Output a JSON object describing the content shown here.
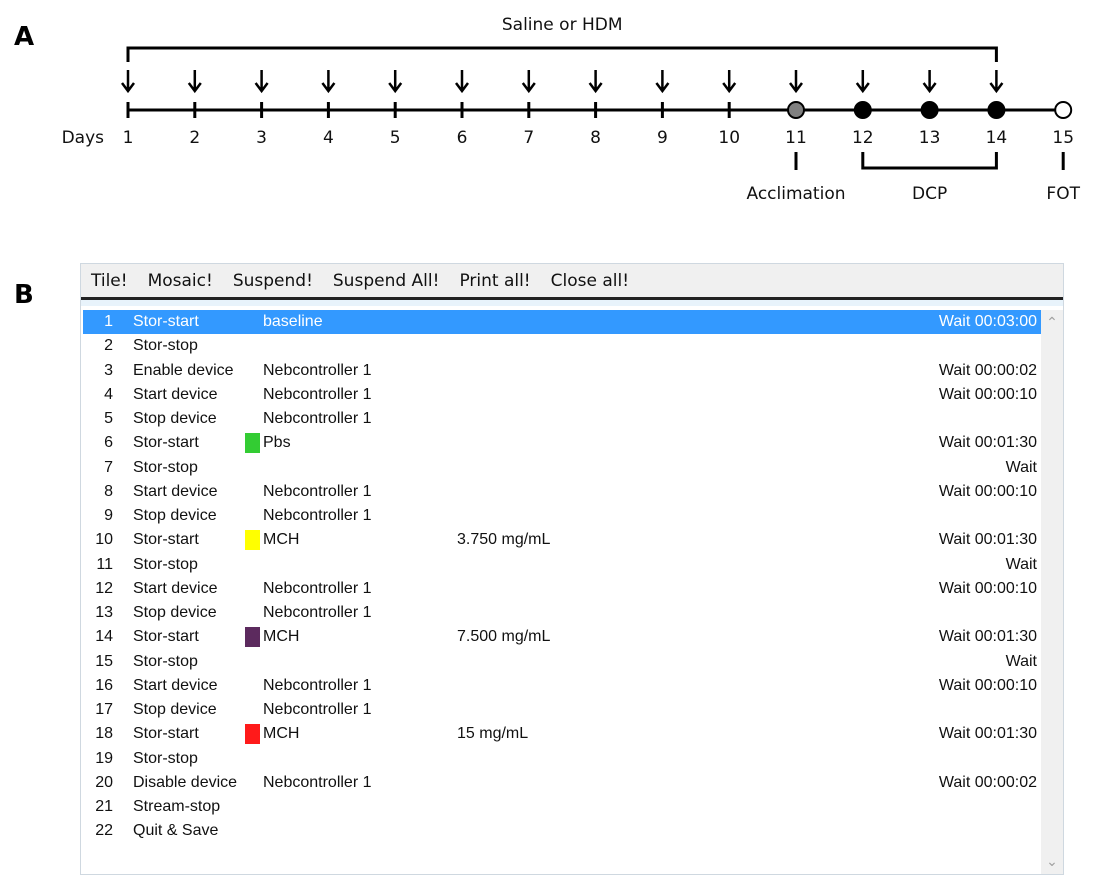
{
  "panel_a": {
    "label": "A",
    "bracket_label": "Saline or HDM",
    "axis_label": "Days",
    "days": [
      {
        "day": "1",
        "arrow": true,
        "marker": "none"
      },
      {
        "day": "2",
        "arrow": true,
        "marker": "none"
      },
      {
        "day": "3",
        "arrow": true,
        "marker": "none"
      },
      {
        "day": "4",
        "arrow": true,
        "marker": "none"
      },
      {
        "day": "5",
        "arrow": true,
        "marker": "none"
      },
      {
        "day": "6",
        "arrow": true,
        "marker": "none"
      },
      {
        "day": "7",
        "arrow": true,
        "marker": "none"
      },
      {
        "day": "8",
        "arrow": true,
        "marker": "none"
      },
      {
        "day": "9",
        "arrow": true,
        "marker": "none"
      },
      {
        "day": "10",
        "arrow": true,
        "marker": "none"
      },
      {
        "day": "11",
        "arrow": true,
        "marker": "gray"
      },
      {
        "day": "12",
        "arrow": true,
        "marker": "black"
      },
      {
        "day": "13",
        "arrow": true,
        "marker": "black"
      },
      {
        "day": "14",
        "arrow": true,
        "marker": "black"
      },
      {
        "day": "15",
        "arrow": false,
        "marker": "white"
      }
    ],
    "annotations": {
      "acclimation": "Acclimation",
      "dcp": "DCP",
      "fot": "FOT"
    },
    "colors": {
      "gray_marker": "#808080",
      "black_marker": "#000000"
    }
  },
  "panel_b": {
    "label": "B",
    "menu": [
      "Tile!",
      "Mosaic!",
      "Suspend!",
      "Suspend All!",
      "Print all!",
      "Close all!"
    ],
    "selection_color": "#3399ff",
    "rows": [
      {
        "num": "1",
        "cmd": "Stor-start",
        "param": "baseline",
        "conc": "",
        "wait": "Wait 00:03:00",
        "swatch": "",
        "selected": true
      },
      {
        "num": "2",
        "cmd": "Stor-stop",
        "param": "",
        "conc": "",
        "wait": "",
        "swatch": ""
      },
      {
        "num": "3",
        "cmd": "Enable device",
        "param": "Nebcontroller 1",
        "conc": "",
        "wait": "Wait 00:00:02",
        "swatch": ""
      },
      {
        "num": "4",
        "cmd": "Start device",
        "param": "Nebcontroller 1",
        "conc": "",
        "wait": "Wait 00:00:10",
        "swatch": ""
      },
      {
        "num": "5",
        "cmd": "Stop device",
        "param": "Nebcontroller 1",
        "conc": "",
        "wait": "",
        "swatch": ""
      },
      {
        "num": "6",
        "cmd": "Stor-start",
        "param": "Pbs",
        "conc": "",
        "wait": "Wait 00:01:30",
        "swatch": "#33cc33"
      },
      {
        "num": "7",
        "cmd": "Stor-stop",
        "param": "",
        "conc": "",
        "wait": "Wait",
        "swatch": ""
      },
      {
        "num": "8",
        "cmd": "Start device",
        "param": "Nebcontroller 1",
        "conc": "",
        "wait": "Wait 00:00:10",
        "swatch": ""
      },
      {
        "num": "9",
        "cmd": "Stop device",
        "param": "Nebcontroller 1",
        "conc": "",
        "wait": "",
        "swatch": ""
      },
      {
        "num": "10",
        "cmd": "Stor-start",
        "param": "MCH",
        "conc": "3.750 mg/mL",
        "wait": "Wait 00:01:30",
        "swatch": "#ffff00"
      },
      {
        "num": "11",
        "cmd": "Stor-stop",
        "param": "",
        "conc": "",
        "wait": "Wait",
        "swatch": ""
      },
      {
        "num": "12",
        "cmd": "Start device",
        "param": "Nebcontroller 1",
        "conc": "",
        "wait": "Wait 00:00:10",
        "swatch": ""
      },
      {
        "num": "13",
        "cmd": "Stop device",
        "param": "Nebcontroller 1",
        "conc": "",
        "wait": "",
        "swatch": ""
      },
      {
        "num": "14",
        "cmd": "Stor-start",
        "param": "MCH",
        "conc": "7.500 mg/mL",
        "wait": "Wait 00:01:30",
        "swatch": "#5c2a5e"
      },
      {
        "num": "15",
        "cmd": "Stor-stop",
        "param": "",
        "conc": "",
        "wait": "Wait",
        "swatch": ""
      },
      {
        "num": "16",
        "cmd": "Start device",
        "param": "Nebcontroller 1",
        "conc": "",
        "wait": "Wait 00:00:10",
        "swatch": ""
      },
      {
        "num": "17",
        "cmd": "Stop device",
        "param": "Nebcontroller 1",
        "conc": "",
        "wait": "",
        "swatch": ""
      },
      {
        "num": "18",
        "cmd": "Stor-start",
        "param": "MCH",
        "conc": " 15 mg/mL",
        "wait": "Wait 00:01:30",
        "swatch": "#ff1a1a"
      },
      {
        "num": "19",
        "cmd": "Stor-stop",
        "param": "",
        "conc": "",
        "wait": "",
        "swatch": ""
      },
      {
        "num": "20",
        "cmd": "Disable device",
        "param": "Nebcontroller 1",
        "conc": "",
        "wait": "Wait 00:00:02",
        "swatch": ""
      },
      {
        "num": "21",
        "cmd": "Stream-stop",
        "param": "",
        "conc": "",
        "wait": "",
        "swatch": ""
      },
      {
        "num": "22",
        "cmd": "Quit & Save",
        "param": "",
        "conc": "",
        "wait": "",
        "swatch": ""
      }
    ]
  }
}
